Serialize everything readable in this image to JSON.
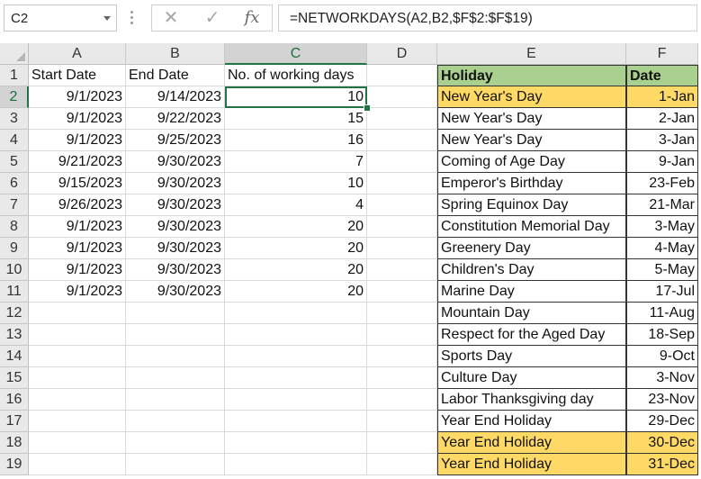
{
  "name_box": "C2",
  "formula": "=NETWORKDAYS(A2,B2,$F$2:$F$19)",
  "columns": [
    "A",
    "B",
    "C",
    "D",
    "E",
    "F"
  ],
  "selected_column": "C",
  "rows": [
    "1",
    "2",
    "3",
    "4",
    "5",
    "6",
    "7",
    "8",
    "9",
    "10",
    "11",
    "12",
    "13",
    "14",
    "15",
    "16",
    "17",
    "18",
    "19"
  ],
  "selected_row": "2",
  "headers": {
    "a": "Start Date",
    "b": "End Date",
    "c": "No. of working days",
    "e": "Holiday",
    "f": "Date"
  },
  "data": [
    {
      "a": "9/1/2023",
      "b": "9/14/2023",
      "c": "10"
    },
    {
      "a": "9/1/2023",
      "b": "9/22/2023",
      "c": "15"
    },
    {
      "a": "9/1/2023",
      "b": "9/25/2023",
      "c": "16"
    },
    {
      "a": "9/21/2023",
      "b": "9/30/2023",
      "c": "7"
    },
    {
      "a": "9/15/2023",
      "b": "9/30/2023",
      "c": "10"
    },
    {
      "a": "9/26/2023",
      "b": "9/30/2023",
      "c": "4"
    },
    {
      "a": "9/1/2023",
      "b": "9/30/2023",
      "c": "20"
    },
    {
      "a": "9/1/2023",
      "b": "9/30/2023",
      "c": "20"
    },
    {
      "a": "9/1/2023",
      "b": "9/30/2023",
      "c": "20"
    },
    {
      "a": "9/1/2023",
      "b": "9/30/2023",
      "c": "20"
    }
  ],
  "holidays": [
    {
      "name": "New Year's Day",
      "date": "1-Jan",
      "highlight": true
    },
    {
      "name": "New Year's Day",
      "date": "2-Jan",
      "highlight": false
    },
    {
      "name": "New Year's Day",
      "date": "3-Jan",
      "highlight": false
    },
    {
      "name": "Coming of Age Day",
      "date": "9-Jan",
      "highlight": false
    },
    {
      "name": "Emperor's Birthday",
      "date": "23-Feb",
      "highlight": false
    },
    {
      "name": "Spring Equinox Day",
      "date": "21-Mar",
      "highlight": false
    },
    {
      "name": "Constitution Memorial Day",
      "date": "3-May",
      "highlight": false
    },
    {
      "name": "Greenery Day",
      "date": "4-May",
      "highlight": false
    },
    {
      "name": "Children's Day",
      "date": "5-May",
      "highlight": false
    },
    {
      "name": "Marine Day",
      "date": "17-Jul",
      "highlight": false
    },
    {
      "name": "Mountain Day",
      "date": "11-Aug",
      "highlight": false
    },
    {
      "name": "Respect for the Aged Day",
      "date": "18-Sep",
      "highlight": false
    },
    {
      "name": "Sports Day",
      "date": "9-Oct",
      "highlight": false
    },
    {
      "name": "Culture Day",
      "date": "3-Nov",
      "highlight": false
    },
    {
      "name": "Labor Thanksgiving day",
      "date": "23-Nov",
      "highlight": false
    },
    {
      "name": "Year End Holiday",
      "date": "29-Dec",
      "highlight": false
    },
    {
      "name": "Year End Holiday",
      "date": "30-Dec",
      "highlight": true
    },
    {
      "name": "Year End Holiday",
      "date": "31-Dec",
      "highlight": true
    }
  ],
  "colors": {
    "accent": "#217346",
    "header_green": "#a9d08e",
    "highlight_yellow": "#ffd966"
  }
}
